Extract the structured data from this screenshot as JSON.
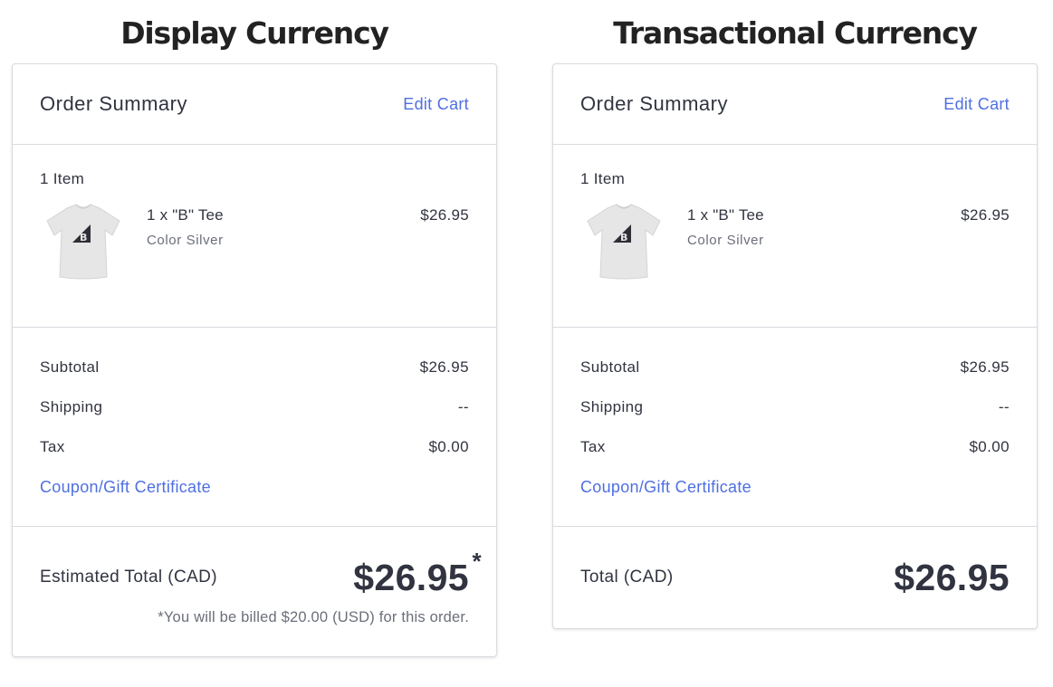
{
  "display": {
    "heading": "Display Currency",
    "summary_title": "Order Summary",
    "edit_cart": "Edit Cart",
    "items_count": "1 Item",
    "item": {
      "name": "1 x \"B\" Tee",
      "option": "Color Silver",
      "price": "$26.95"
    },
    "subtotal_label": "Subtotal",
    "subtotal_value": "$26.95",
    "shipping_label": "Shipping",
    "shipping_value": "--",
    "tax_label": "Tax",
    "tax_value": "$0.00",
    "coupon": "Coupon/Gift Certificate",
    "total_label": "Estimated Total (CAD)",
    "total_value": "$26.95",
    "asterisk": "*",
    "billing_note": "*You will be billed $20.00 (USD) for this order."
  },
  "transactional": {
    "heading": "Transactional Currency",
    "summary_title": "Order Summary",
    "edit_cart": "Edit Cart",
    "items_count": "1 Item",
    "item": {
      "name": "1 x \"B\" Tee",
      "option": "Color Silver",
      "price": "$26.95"
    },
    "subtotal_label": "Subtotal",
    "subtotal_value": "$26.95",
    "shipping_label": "Shipping",
    "shipping_value": "--",
    "tax_label": "Tax",
    "tax_value": "$0.00",
    "coupon": "Coupon/Gift Certificate",
    "total_label": "Total (CAD)",
    "total_value": "$26.95"
  },
  "colors": {
    "link": "#4f6fe0",
    "text": "#313440",
    "muted": "#6b6f7a",
    "border": "#d9dbe0"
  },
  "icons": {
    "product": "tshirt-icon"
  }
}
